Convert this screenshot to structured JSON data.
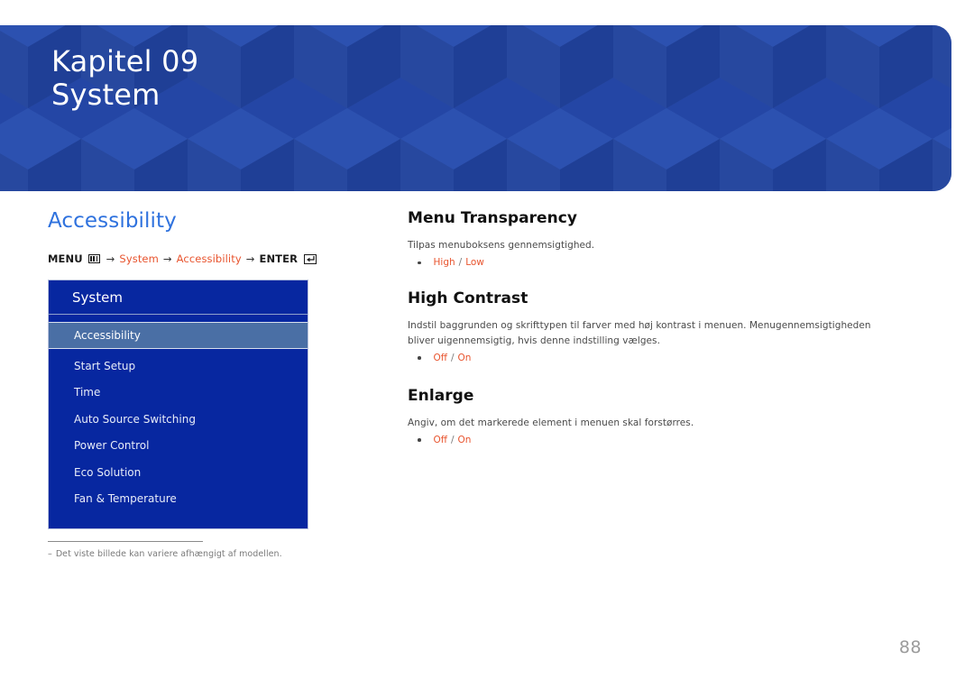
{
  "banner": {
    "chapter": "Kapitel 09",
    "title": "System",
    "bg_color": "#2446A5"
  },
  "left": {
    "section_title": "Accessibility",
    "menu_path": {
      "menu_label": "MENU",
      "menu_icon": "menu-grid-icon",
      "arrow1": "→",
      "item1": "System",
      "arrow2": "→",
      "item2": "Accessibility",
      "arrow3": "→",
      "enter_label": "ENTER",
      "enter_icon": "enter-key-icon",
      "accent_color": "#E8542E"
    },
    "osd": {
      "header": "System",
      "items": [
        {
          "label": "Accessibility",
          "selected": true
        },
        {
          "label": "Start Setup",
          "selected": false
        },
        {
          "label": "Time",
          "selected": false
        },
        {
          "label": "Auto Source Switching",
          "selected": false
        },
        {
          "label": "Power Control",
          "selected": false
        },
        {
          "label": "Eco Solution",
          "selected": false
        },
        {
          "label": "Fan & Temperature",
          "selected": false
        }
      ],
      "bg_color": "#0727A0",
      "selected_color": "#4a6fa5"
    },
    "footnote": {
      "dash": "–",
      "text": "Det viste billede kan variere afhængigt af modellen."
    }
  },
  "right": {
    "blocks": [
      {
        "heading": "Menu Transparency",
        "description": "Tilpas menuboksens gennemsigtighed.",
        "option_a": "High",
        "separator": "/",
        "option_b": "Low"
      },
      {
        "heading": "High Contrast",
        "description": "Indstil baggrunden og skrifttypen til farver med høj kontrast i menuen. Menugennemsigtigheden bliver uigennemsigtig, hvis denne indstilling vælges.",
        "option_a": "Off",
        "separator": "/",
        "option_b": "On"
      },
      {
        "heading": "Enlarge",
        "description": "Angiv, om det markerede element i menuen skal forstørres.",
        "option_a": "Off",
        "separator": "/",
        "option_b": "On"
      }
    ]
  },
  "page_number": "88"
}
